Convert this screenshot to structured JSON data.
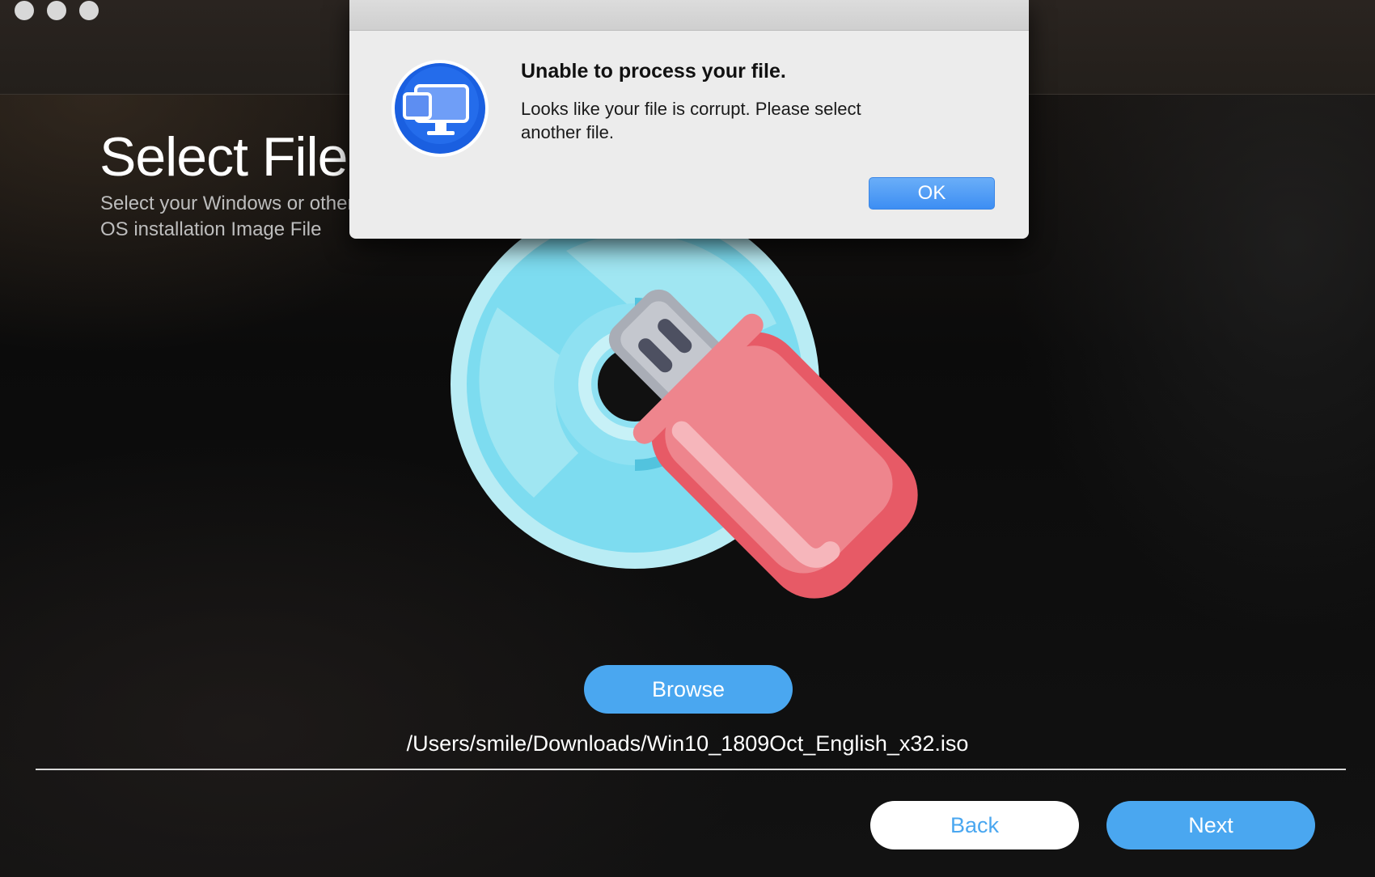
{
  "window": {
    "traffic_lights": [
      "close",
      "minimize",
      "zoom"
    ]
  },
  "page": {
    "title": "Select File",
    "subtitle": "Select your Windows or other OS installation Image File"
  },
  "main": {
    "browse_label": "Browse",
    "file_path": "/Users/smile/Downloads/Win10_1809Oct_English_x32.iso",
    "illustration_icons": [
      "disc-icon",
      "usb-drive-icon"
    ]
  },
  "footer": {
    "back_label": "Back",
    "next_label": "Next"
  },
  "alert": {
    "title": "Unable to process your file.",
    "message": "Looks like your file is corrupt. Please select\nanother  file.",
    "ok_label": "OK",
    "icon": "app-monitor-icon"
  },
  "colors": {
    "accent": "#4aa7f0",
    "alert_bg": "#ececec",
    "ok_button": "#3d8ef3"
  }
}
